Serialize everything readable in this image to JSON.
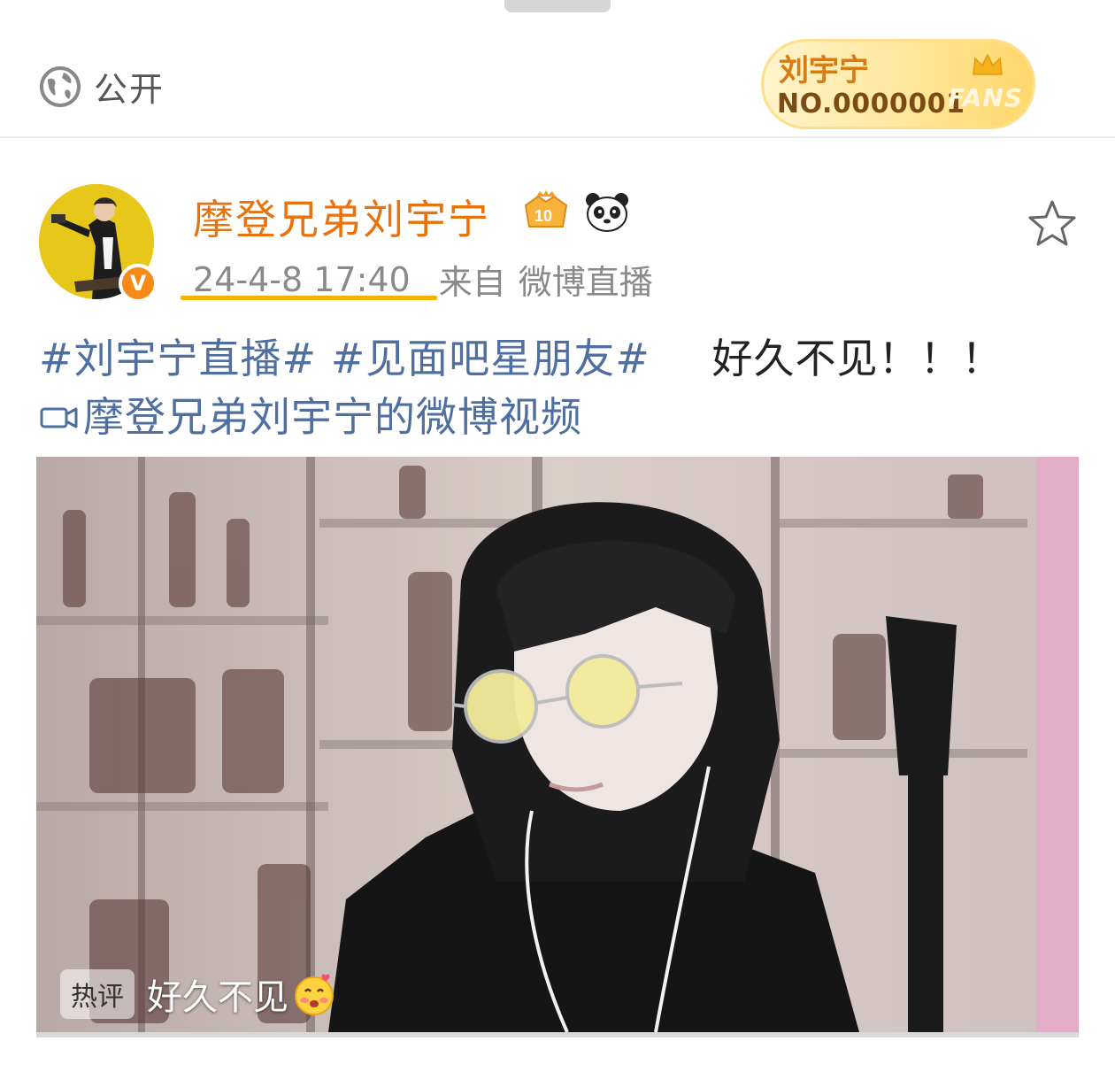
{
  "header": {
    "visibility_label": "公开",
    "fans_badge": {
      "name": "刘宇宁",
      "number": "NO.0000001",
      "word": "FANS"
    }
  },
  "post": {
    "author_name": "摩登兄弟刘宇宁",
    "verified_mark": "V",
    "level_badge_text": "10",
    "timestamp": "24-4-8 17:40",
    "source_prefix": "来自",
    "source_name": "微博直播",
    "hashtags": [
      "#刘宇宁直播#",
      "#见面吧星朋友#"
    ],
    "body_text": "好久不见！！！",
    "video_link_text": "摩登兄弟刘宇宁的微博视频"
  },
  "video": {
    "hot_comment_tag": "热评",
    "hot_comment_text": "好久不见"
  },
  "colors": {
    "author": "#e8720c",
    "link": "#4e6fa0",
    "underline_highlight": "#f5b200",
    "fans_badge_gold": "#ffd76a"
  },
  "icons": [
    "globe-icon",
    "crown-icon",
    "verified-badge",
    "level-badge-icon",
    "panda-icon",
    "star-icon",
    "video-camera-icon",
    "blushing-emoji-icon"
  ]
}
